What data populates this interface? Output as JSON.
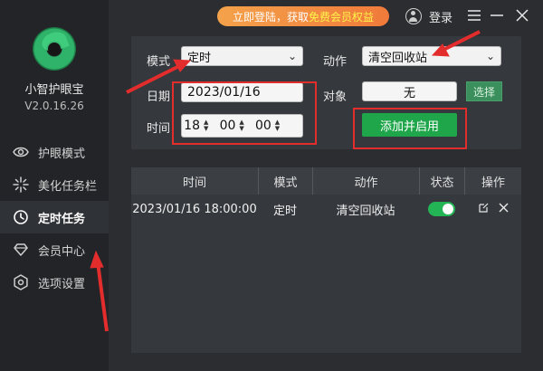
{
  "sidebar": {
    "app_name": "小智护眼宝",
    "version": "V2.0.16.26",
    "items": [
      {
        "label": "护眼模式",
        "icon": "eye-icon"
      },
      {
        "label": "美化任务栏",
        "icon": "sparkle-icon"
      },
      {
        "label": "定时任务",
        "icon": "clock-icon",
        "active": true
      },
      {
        "label": "会员中心",
        "icon": "diamond-icon"
      },
      {
        "label": "选项设置",
        "icon": "settings-icon"
      }
    ]
  },
  "topbar": {
    "promo_prefix": "立即登陆，获取",
    "promo_highlight": "免费会员权益",
    "login_label": "登录"
  },
  "form": {
    "mode_label": "模式",
    "mode_value": "定时",
    "action_label": "动作",
    "action_value": "清空回收站",
    "date_label": "日期",
    "date_value": "2023/01/16",
    "target_label": "对象",
    "target_value": "无",
    "select_button": "选择",
    "time_label": "时间",
    "time_hour": "18",
    "time_minute": "00",
    "time_second": "00",
    "add_button": "添加并启用"
  },
  "table": {
    "columns": [
      "时间",
      "模式",
      "动作",
      "状态",
      "操作"
    ],
    "rows": [
      {
        "time": "2023/01/16 18:00:00",
        "mode": "定时",
        "action": "清空回收站",
        "enabled": true
      }
    ]
  },
  "colors": {
    "accent_green": "#1fa64a",
    "highlight_red": "#e32d2d",
    "promo_orange": "#f07a3a"
  }
}
